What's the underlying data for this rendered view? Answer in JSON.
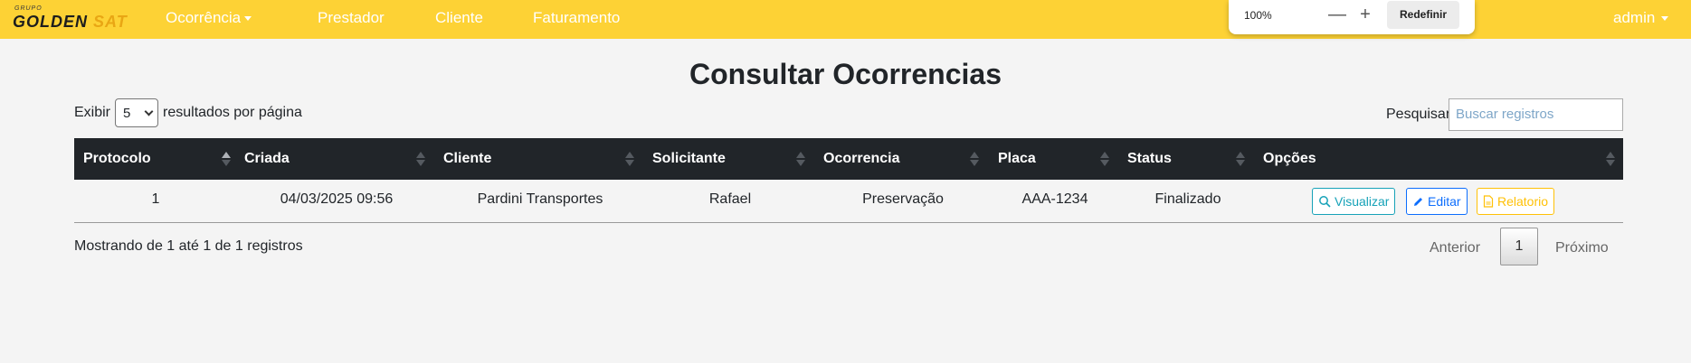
{
  "brand": {
    "small": "GRUPO",
    "golden": "GOLDEN",
    "sat": "SAT"
  },
  "nav": {
    "ocorrencia": "Ocorrência",
    "prestador": "Prestador",
    "cliente": "Cliente",
    "faturamento": "Faturamento",
    "user": "admin"
  },
  "zoom": {
    "level": "100%",
    "minus": "—",
    "plus": "+",
    "reset": "Redefinir"
  },
  "page": {
    "title": "Consultar Ocorrencias"
  },
  "controls": {
    "show_prefix": "Exibir",
    "page_size": "5",
    "show_suffix": "resultados por página",
    "search_label": "Pesquisar",
    "search_placeholder": "Buscar registros"
  },
  "table": {
    "headers": [
      "Protocolo",
      "Criada",
      "Cliente",
      "Solicitante",
      "Ocorrencia",
      "Placa",
      "Status",
      "Opções"
    ],
    "rows": [
      {
        "protocolo": "1",
        "criada": "04/03/2025 09:56",
        "cliente": "Pardini Transportes",
        "solicitante": "Rafael",
        "ocorrencia": "Preservação",
        "placa": "AAA-1234",
        "status": "Finalizado"
      }
    ],
    "actions": {
      "view": "Visualizar",
      "edit": "Editar",
      "report": "Relatorio"
    }
  },
  "footer": {
    "info": "Mostrando de 1 até 1 de 1 registros",
    "prev": "Anterior",
    "page": "1",
    "next": "Próximo"
  },
  "colors": {
    "navbar": "#fdd235",
    "header": "#212529",
    "view": "#17a2b8",
    "edit": "#0d6efd",
    "report": "#ffc107"
  }
}
